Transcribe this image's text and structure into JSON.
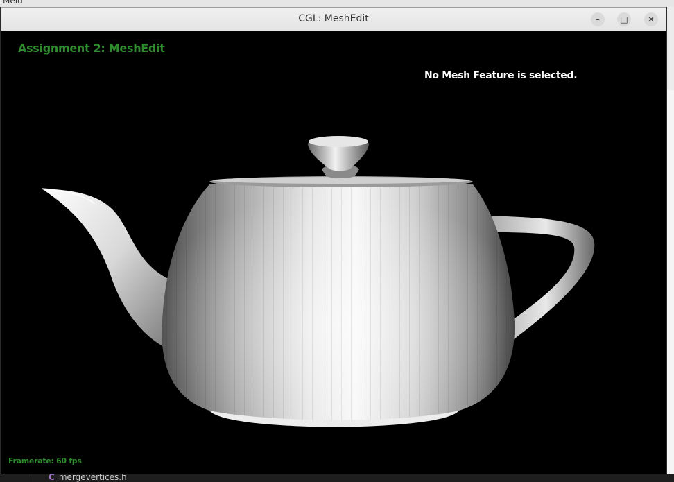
{
  "behind": {
    "top_app_label": "Meld",
    "bottom_file_icon": "c-file-icon",
    "bottom_file_label": "mergevertices.h"
  },
  "window": {
    "title": "CGL: MeshEdit",
    "controls": {
      "minimize_icon": "minimize-icon",
      "maximize_icon": "maximize-icon",
      "close_icon": "close-icon"
    }
  },
  "viewport": {
    "assignment_title": "Assignment 2: MeshEdit",
    "selection_status": "No Mesh Feature is selected.",
    "framerate": "Framerate: 60 fps",
    "model": "teapot",
    "colors": {
      "background": "#000000",
      "overlay_green": "#2e8b2e",
      "overlay_white": "#ffffff"
    }
  }
}
